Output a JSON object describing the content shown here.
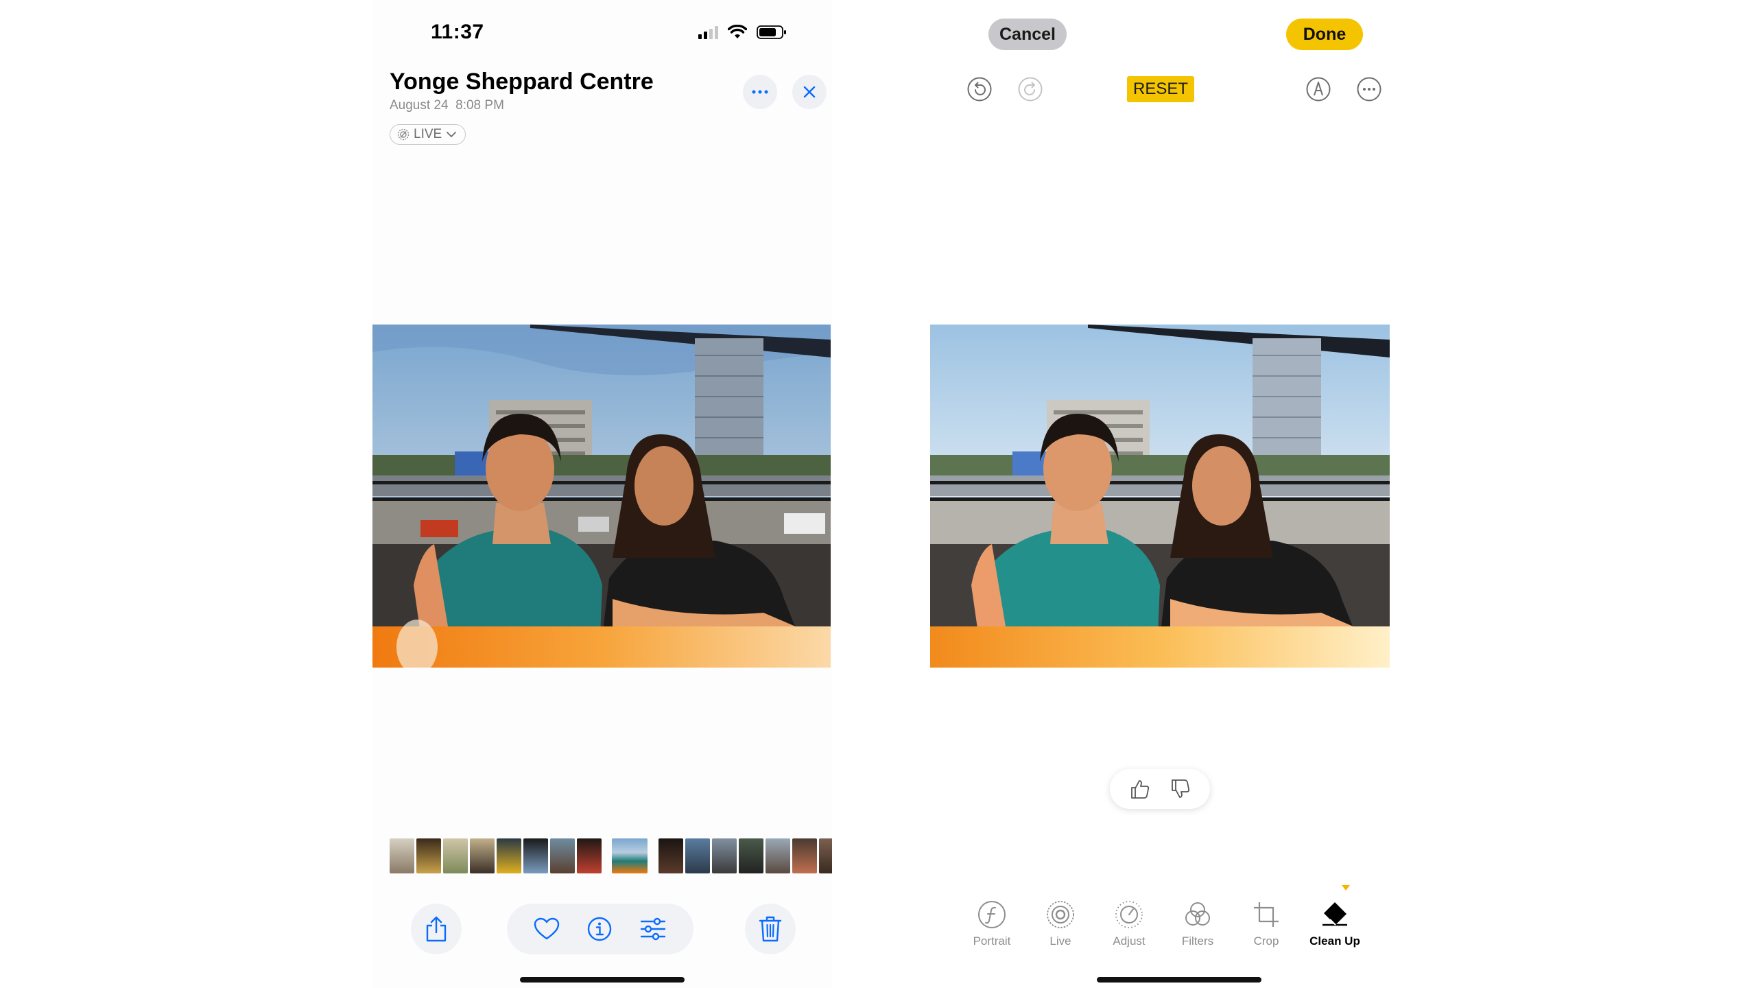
{
  "left": {
    "status_bar": {
      "time": "11:37"
    },
    "header": {
      "title": "Yonge Sheppard Centre",
      "date": "August 24",
      "time": "8:08 PM",
      "live_label": "LIVE"
    },
    "thumbnails_count": 18,
    "toolbar_icons": [
      "share-icon",
      "heart-icon",
      "info-icon",
      "adjustments-icon",
      "trash-icon"
    ]
  },
  "right": {
    "cancel_label": "Cancel",
    "done_label": "Done",
    "reset_label": "RESET",
    "tools": [
      {
        "label": "Portrait",
        "icon": "portrait-f-icon"
      },
      {
        "label": "Live",
        "icon": "live-icon"
      },
      {
        "label": "Adjust",
        "icon": "adjust-dial-icon"
      },
      {
        "label": "Filters",
        "icon": "filters-icon"
      },
      {
        "label": "Crop",
        "icon": "crop-icon"
      },
      {
        "label": "Clean Up",
        "icon": "eraser-icon",
        "active": true
      }
    ]
  },
  "colors": {
    "accent_yellow": "#f5c400",
    "ios_blue": "#0a6bff",
    "cancel_bg": "#c8c8cc",
    "toolbar_bg": "#f1f2f5"
  }
}
